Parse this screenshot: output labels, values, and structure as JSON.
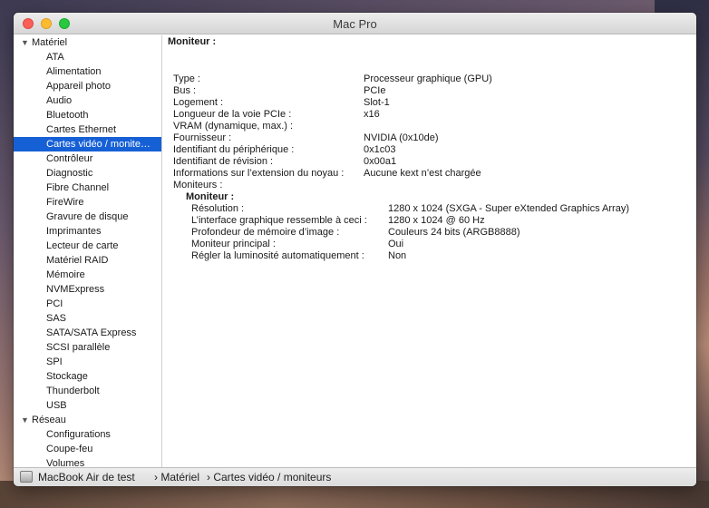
{
  "window": {
    "title": "Mac Pro"
  },
  "sidebar": {
    "groups": [
      {
        "label": "Matériel",
        "items": [
          "ATA",
          "Alimentation",
          "Appareil photo",
          "Audio",
          "Bluetooth",
          "Cartes Ethernet",
          "Cartes vidéo / monite…",
          "Contrôleur",
          "Diagnostic",
          "Fibre Channel",
          "FireWire",
          "Gravure de disque",
          "Imprimantes",
          "Lecteur de carte",
          "Matériel RAID",
          "Mémoire",
          "NVMExpress",
          "PCI",
          "SAS",
          "SATA/SATA Express",
          "SCSI parallèle",
          "SPI",
          "Stockage",
          "Thunderbolt",
          "USB"
        ]
      },
      {
        "label": "Réseau",
        "items": [
          "Configurations",
          "Coupe-feu",
          "Volumes"
        ]
      }
    ],
    "selected": "Cartes vidéo / monite…"
  },
  "content": {
    "heading": "Moniteur :",
    "properties": [
      {
        "key": "Type :",
        "value": "Processeur graphique (GPU)"
      },
      {
        "key": "Bus :",
        "value": "PCIe"
      },
      {
        "key": "Logement :",
        "value": "Slot-1"
      },
      {
        "key": "Longueur de la voie PCIe :",
        "value": "x16"
      },
      {
        "key": "VRAM (dynamique, max.) :",
        "value": ""
      },
      {
        "key": "Fournisseur :",
        "value": "NVIDIA (0x10de)"
      },
      {
        "key": "Identifiant du périphérique :",
        "value": "0x1c03"
      },
      {
        "key": "Identifiant de révision :",
        "value": "0x00a1"
      },
      {
        "key": "Informations sur l’extension du noyau :",
        "value": "Aucune kext n’est chargée"
      },
      {
        "key": "Moniteurs :",
        "value": ""
      }
    ],
    "monitor": {
      "heading": "Moniteur :",
      "properties": [
        {
          "key": "Résolution :",
          "value": "1280 x 1024 (SXGA - Super eXtended Graphics Array)"
        },
        {
          "key": "L’interface graphique ressemble à ceci :",
          "value": "1280 x 1024 @ 60 Hz"
        },
        {
          "key": "Profondeur de mémoire d’image :",
          "value": "Couleurs 24 bits (ARGB8888)"
        },
        {
          "key": "Moniteur principal :",
          "value": "Oui"
        },
        {
          "key": "Régler la luminosité automatiquement :",
          "value": "Non"
        }
      ]
    }
  },
  "statusbar": {
    "crumbs": [
      "MacBook Air de test",
      "Matériel",
      "Cartes vidéo / moniteurs"
    ],
    "separator": "›"
  },
  "colors": {
    "selection": "#1660d6",
    "close": "#fc5f57",
    "minimize": "#fdbc2e",
    "maximize": "#28c840"
  },
  "icons": {
    "computer": "computer-icon",
    "group_toggle": "disclosure-triangle-icon"
  }
}
